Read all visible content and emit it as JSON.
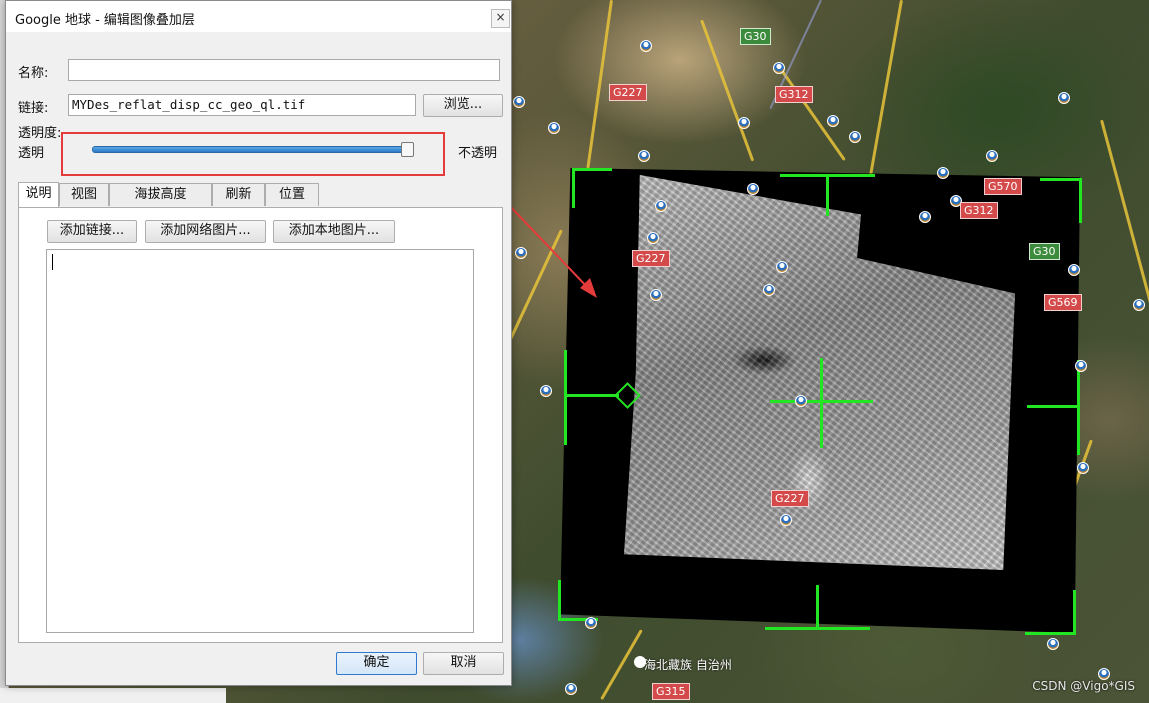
{
  "dialog": {
    "title": "Google 地球 - 编辑图像叠加层",
    "close_symbol": "×",
    "name_label": "名称:",
    "name_value": "",
    "link_label": "链接:",
    "link_value": "MYDes_reflat_disp_cc_geo_ql.tif",
    "browse_button": "浏览...",
    "transparency_label": "透明度:",
    "slider_left_label": "透明",
    "slider_right_label": "不透明",
    "slider_level": 1.0,
    "tabs": [
      "说明",
      "视图",
      "海拔高度",
      "刷新",
      "位置"
    ],
    "active_tab": "说明",
    "add_link_button": "添加链接...",
    "add_web_image_button": "添加网络图片...",
    "add_local_image_button": "添加本地图片...",
    "description_value": "",
    "ok_button": "确定",
    "cancel_button": "取消"
  },
  "map": {
    "road_labels": [
      "G227",
      "G312",
      "G570",
      "G312",
      "G30",
      "G227",
      "G569",
      "G227",
      "G315",
      "G30"
    ],
    "place_label": "海北藏族 自治州",
    "watermark": "CSDN @Vigo*GIS"
  },
  "colors": {
    "highlight_box": "#e53b3b",
    "slider_fill": "#2b7bc6",
    "overlay_outline": "#22e622",
    "road_badge": "#d44a4a"
  }
}
